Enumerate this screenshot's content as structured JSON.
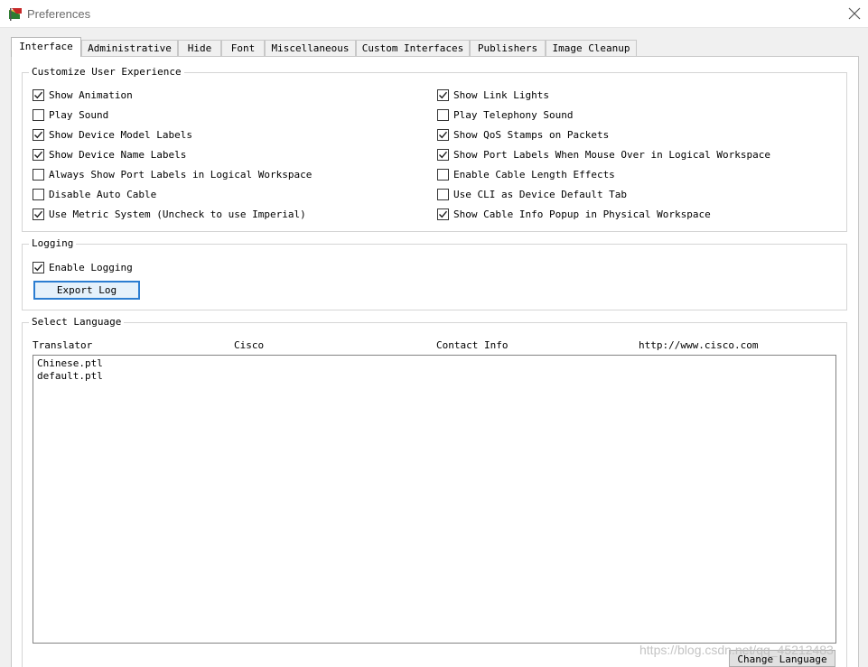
{
  "window": {
    "title": "Preferences"
  },
  "tabs": [
    {
      "label": "Interface",
      "active": true
    },
    {
      "label": "Administrative"
    },
    {
      "label": "Hide"
    },
    {
      "label": "Font"
    },
    {
      "label": "Miscellaneous"
    },
    {
      "label": "Custom Interfaces"
    },
    {
      "label": "Publishers"
    },
    {
      "label": "Image Cleanup"
    }
  ],
  "customize": {
    "legend": "Customize User Experience",
    "left": [
      {
        "label": "Show Animation",
        "checked": true
      },
      {
        "label": "Play Sound",
        "checked": false
      },
      {
        "label": "Show Device Model Labels",
        "checked": true
      },
      {
        "label": "Show Device Name Labels",
        "checked": true
      },
      {
        "label": "Always Show Port Labels in Logical Workspace",
        "checked": false
      },
      {
        "label": "Disable Auto Cable",
        "checked": false
      },
      {
        "label": "Use Metric System (Uncheck to use Imperial)",
        "checked": true
      }
    ],
    "right": [
      {
        "label": "Show Link Lights",
        "checked": true
      },
      {
        "label": "Play Telephony Sound",
        "checked": false
      },
      {
        "label": "Show QoS Stamps on Packets",
        "checked": true
      },
      {
        "label": "Show Port Labels When Mouse Over in Logical Workspace",
        "checked": true
      },
      {
        "label": "Enable Cable Length Effects",
        "checked": false
      },
      {
        "label": "Use CLI as Device Default Tab",
        "checked": false
      },
      {
        "label": "Show Cable Info Popup in Physical Workspace",
        "checked": true
      }
    ]
  },
  "logging": {
    "legend": "Logging",
    "enable": {
      "label": "Enable Logging",
      "checked": true
    },
    "export_button": "Export Log"
  },
  "language": {
    "legend": "Select Language",
    "headers": [
      "Translator",
      "Cisco",
      "Contact Info",
      "http://www.cisco.com"
    ],
    "items": [
      "Chinese.ptl",
      "default.ptl"
    ],
    "change_button": "Change Language"
  },
  "watermark": "https://blog.csdn.net/qq_45212483"
}
